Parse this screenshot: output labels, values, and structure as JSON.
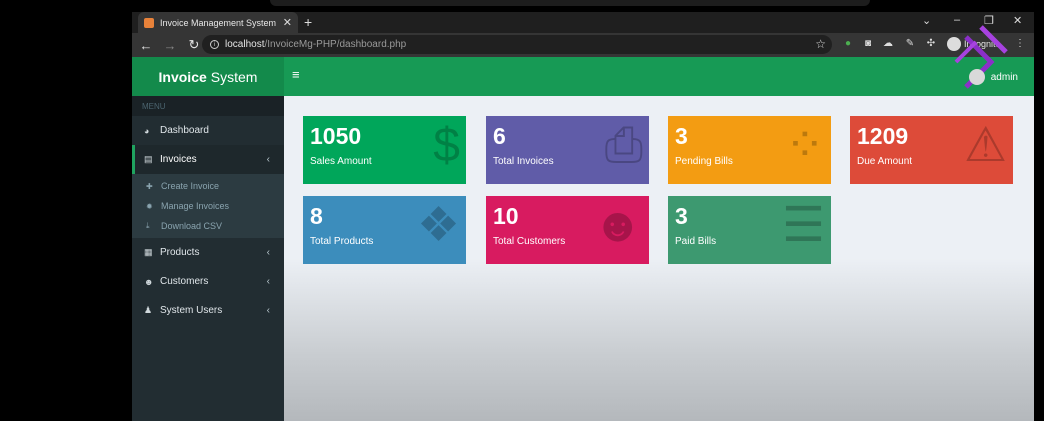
{
  "browser": {
    "tab_title": "Invoice Management System",
    "url_host": "localhost",
    "url_path": "/InvoiceMg-PHP/dashboard.php",
    "incognito_label": "Incognito"
  },
  "app": {
    "logo_bold": "Invoice",
    "logo_rest": "System",
    "user_name": "admin",
    "menu_label": "MENU"
  },
  "sidebar": {
    "items": [
      {
        "label": "Dashboard",
        "icon": "tachometer-icon"
      },
      {
        "label": "Invoices",
        "icon": "file-icon"
      },
      {
        "label": "Products",
        "icon": "table-icon"
      },
      {
        "label": "Customers",
        "icon": "users-icon"
      },
      {
        "label": "System Users",
        "icon": "user-icon"
      }
    ],
    "invoices_sub": [
      {
        "label": "Create Invoice",
        "icon": "plus-icon"
      },
      {
        "label": "Manage Invoices",
        "icon": "gear-icon"
      },
      {
        "label": "Download CSV",
        "icon": "download-icon"
      }
    ]
  },
  "boxes": [
    {
      "value": "1050",
      "label": "Sales Amount",
      "color": "#00a65a",
      "icon": "dollar-icon"
    },
    {
      "value": "6",
      "label": "Total Invoices",
      "color": "#605ca8",
      "icon": "printer-icon"
    },
    {
      "value": "3",
      "label": "Pending Bills",
      "color": "#f39c12",
      "icon": "spinner-icon"
    },
    {
      "value": "1209",
      "label": "Due Amount",
      "color": "#dd4b39",
      "icon": "warning-icon"
    },
    {
      "value": "8",
      "label": "Total Products",
      "color": "#3c8dbc",
      "icon": "dropbox-icon"
    },
    {
      "value": "10",
      "label": "Total Customers",
      "color": "#d81b60",
      "icon": "users-icon"
    },
    {
      "value": "3",
      "label": "Paid Bills",
      "color": "#3d9970",
      "icon": "list-icon"
    }
  ]
}
